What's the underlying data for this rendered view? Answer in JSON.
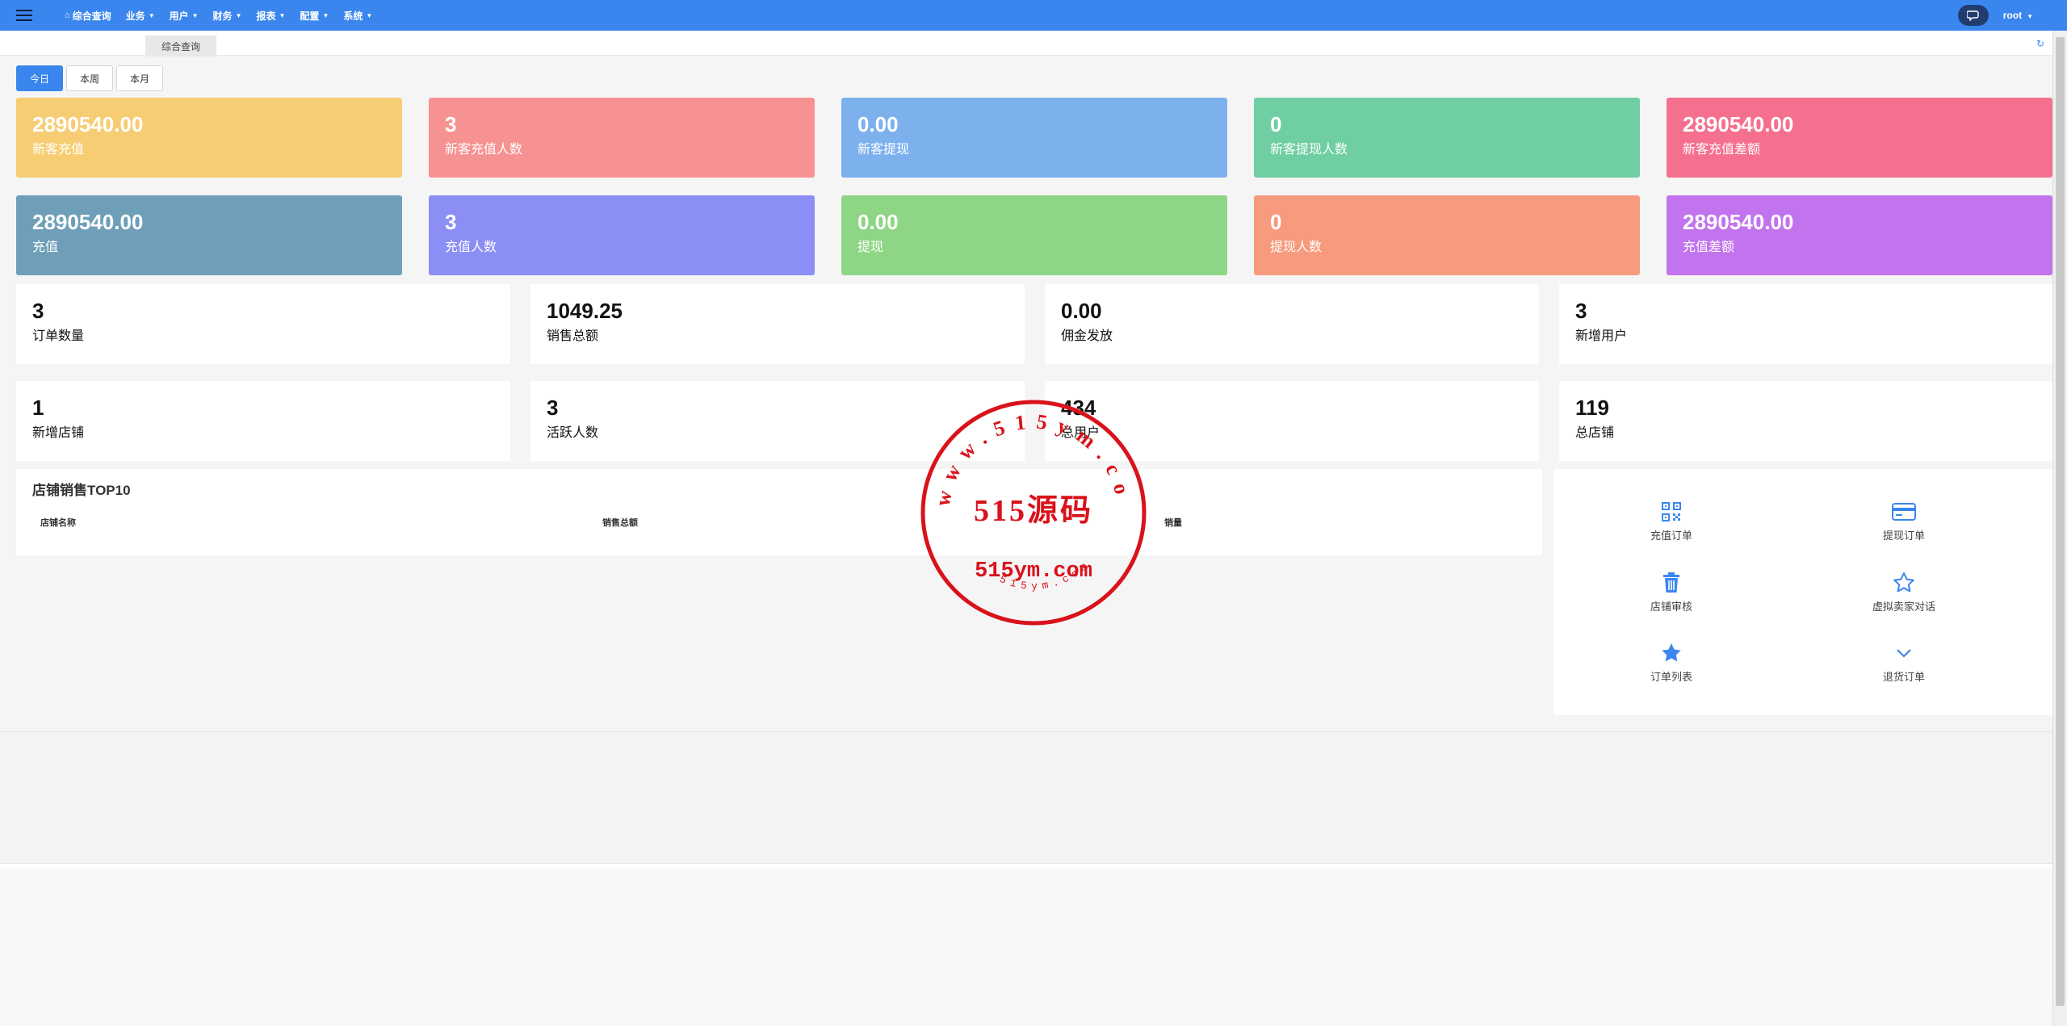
{
  "topbar": {
    "nav": [
      {
        "label": "综合查询",
        "home": true
      },
      {
        "label": "业务",
        "caret": true
      },
      {
        "label": "用户",
        "caret": true
      },
      {
        "label": "财务",
        "caret": true
      },
      {
        "label": "报表",
        "caret": true
      },
      {
        "label": "配置",
        "caret": true
      },
      {
        "label": "系统",
        "caret": true
      }
    ],
    "user": "root"
  },
  "tabs": {
    "active": "综合查询"
  },
  "periods": [
    "今日",
    "本周",
    "本月"
  ],
  "color_cards": [
    {
      "value": "2890540.00",
      "label": "新客充值",
      "color": "#f7cd74"
    },
    {
      "value": "3",
      "label": "新客充值人数",
      "color": "#f79292"
    },
    {
      "value": "0.00",
      "label": "新客提现",
      "color": "#7db1ee"
    },
    {
      "value": "0",
      "label": "新客提现人数",
      "color": "#6fcfa3"
    },
    {
      "value": "2890540.00",
      "label": "新客充值差额",
      "color": "#f5708f"
    },
    {
      "value": "2890540.00",
      "label": "充值",
      "color": "#6f9fb8"
    },
    {
      "value": "3",
      "label": "充值人数",
      "color": "#8a8ef5"
    },
    {
      "value": "0.00",
      "label": "提现",
      "color": "#8ed685"
    },
    {
      "value": "0",
      "label": "提现人数",
      "color": "#f79a7d"
    },
    {
      "value": "2890540.00",
      "label": "充值差额",
      "color": "#c274ee"
    }
  ],
  "stat_cards": [
    {
      "value": "3",
      "label": "订单数量"
    },
    {
      "value": "1049.25",
      "label": "销售总额"
    },
    {
      "value": "0.00",
      "label": "佣金发放"
    },
    {
      "value": "3",
      "label": "新增用户"
    },
    {
      "value": "1",
      "label": "新增店铺"
    },
    {
      "value": "3",
      "label": "活跃人数"
    },
    {
      "value": "434",
      "label": "总用户"
    },
    {
      "value": "119",
      "label": "总店铺"
    }
  ],
  "top10": {
    "title": "店铺销售TOP10",
    "columns": [
      "店铺名称",
      "销售总额",
      "销量"
    ]
  },
  "quick_links": [
    {
      "label": "充值订单",
      "icon": "qrcode-icon"
    },
    {
      "label": "提现订单",
      "icon": "credit-card-icon"
    },
    {
      "label": "店铺审核",
      "icon": "trash-icon"
    },
    {
      "label": "虚拟卖家对话",
      "icon": "star-outline-icon"
    },
    {
      "label": "订单列表",
      "icon": "star-filled-icon"
    },
    {
      "label": "退货订单",
      "icon": "chevron-down-icon"
    }
  ],
  "watermark": {
    "center_text": "515源码",
    "domain_text": "515ym.com",
    "ring_text": "www.515ym.com",
    "small_ring_text": "515ym.com",
    "color": "#d9121b"
  }
}
